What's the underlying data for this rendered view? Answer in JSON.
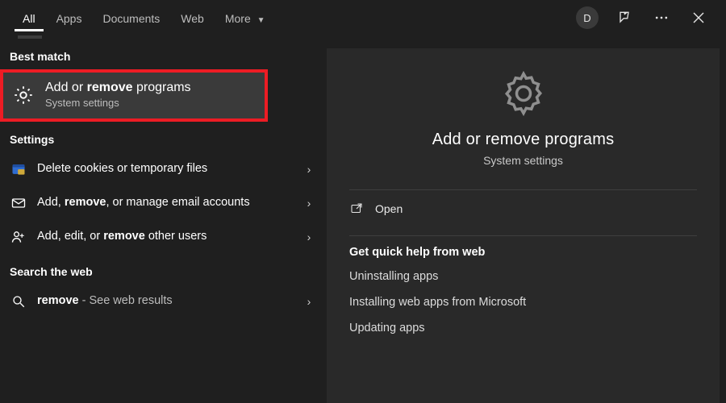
{
  "topbar": {
    "tabs": {
      "all": "All",
      "apps": "Apps",
      "documents": "Documents",
      "web": "Web",
      "more": "More"
    },
    "avatar_initial": "D"
  },
  "left": {
    "best_match_header": "Best match",
    "best_match": {
      "title_pre": "Add or ",
      "title_bold": "remove",
      "title_post": " programs",
      "subtitle": "System settings"
    },
    "settings_header": "Settings",
    "settings": [
      {
        "label": "Delete cookies or temporary files"
      },
      {
        "pre": "Add, ",
        "bold": "remove",
        "post": ", or manage email accounts"
      },
      {
        "pre": "Add, edit, or ",
        "bold": "remove",
        "post": " other users"
      }
    ],
    "web_header": "Search the web",
    "web": {
      "bold": "remove",
      "post": " - See web results"
    }
  },
  "right": {
    "title": "Add or remove programs",
    "subtitle": "System settings",
    "open_label": "Open",
    "quick_header": "Get quick help from web",
    "quick_links": [
      "Uninstalling apps",
      "Installing web apps from Microsoft",
      "Updating apps"
    ]
  }
}
